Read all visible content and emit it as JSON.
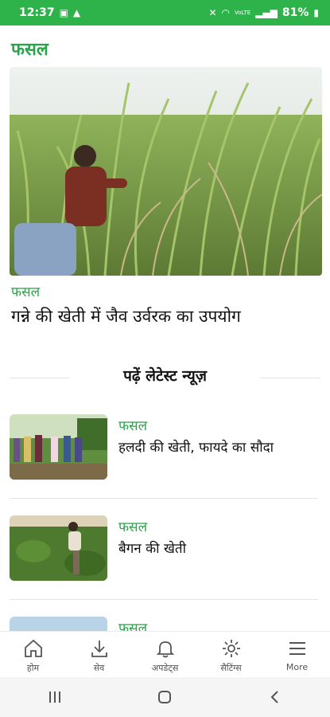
{
  "status_bar": {
    "time": "12:37",
    "battery": "81%",
    "signal": "VoLTE"
  },
  "section": {
    "title": "फसल"
  },
  "hero": {
    "category": "फसल",
    "title": "गन्ने की खेती में जैव उर्वरक का उपयोग"
  },
  "latest": {
    "heading": "पढ़ें लेटेस्ट न्यूज़"
  },
  "news": [
    {
      "category": "फसल",
      "title": "हलदी की खेती, फायदे का सौदा"
    },
    {
      "category": "फसल",
      "title": "बैगन की खेती"
    },
    {
      "category": "फसल",
      "title": ""
    }
  ],
  "bottom_nav": {
    "items": [
      {
        "label": "होम",
        "icon": "home-icon"
      },
      {
        "label": "सेव",
        "icon": "download-icon"
      },
      {
        "label": "अपडेट्स",
        "icon": "bell-icon"
      },
      {
        "label": "सैटिंग्स",
        "icon": "gear-icon"
      },
      {
        "label": "More",
        "icon": "menu-icon"
      }
    ]
  },
  "colors": {
    "accent": "#2db34a",
    "text_green": "#2aa34a"
  }
}
